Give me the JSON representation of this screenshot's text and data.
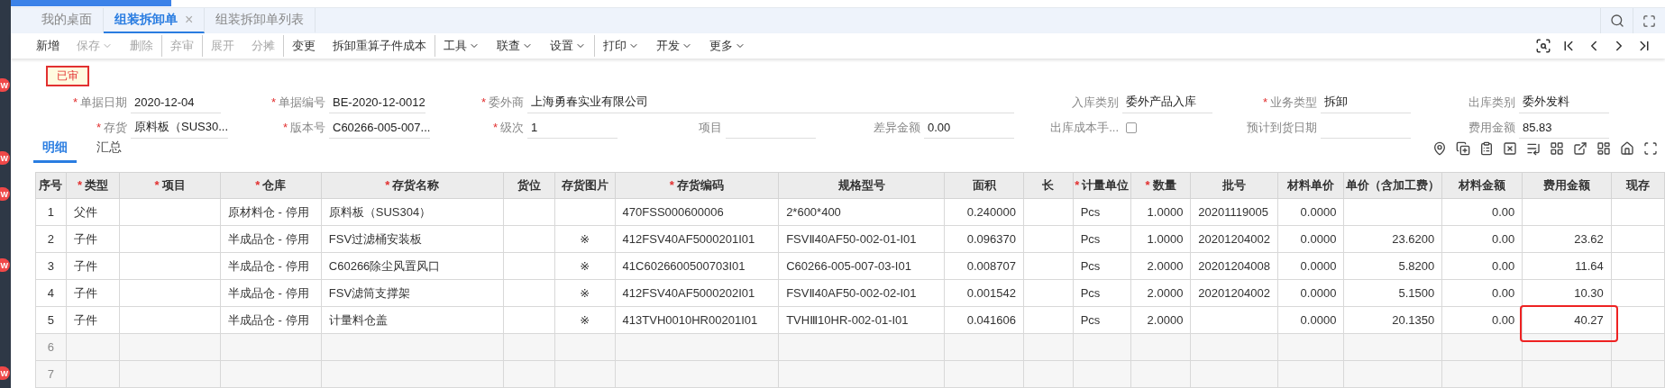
{
  "side_badges": [
    "W",
    "W",
    "W",
    "W",
    "W"
  ],
  "tabs": [
    {
      "label": "我的桌面",
      "selected": false,
      "closable": false
    },
    {
      "label": "组装拆卸单",
      "selected": true,
      "closable": true
    },
    {
      "label": "组装拆卸单列表",
      "selected": false,
      "closable": false
    }
  ],
  "close_glyph": "×",
  "toolbar": [
    {
      "label": "新增",
      "disabled": false,
      "dropdown": false,
      "separator_before": false
    },
    {
      "label": "保存",
      "disabled": true,
      "dropdown": true,
      "separator_before": false
    },
    {
      "label": "删除",
      "disabled": true,
      "dropdown": false,
      "separator_before": false
    },
    {
      "label": "弃审",
      "disabled": true,
      "dropdown": false,
      "separator_before": true
    },
    {
      "label": "展开",
      "disabled": true,
      "dropdown": false,
      "separator_before": true
    },
    {
      "label": "分摊",
      "disabled": true,
      "dropdown": false,
      "separator_before": false
    },
    {
      "label": "变更",
      "disabled": false,
      "dropdown": false,
      "separator_before": true
    },
    {
      "label": "拆卸重算子件成本",
      "disabled": false,
      "dropdown": false,
      "separator_before": false
    },
    {
      "label": "工具",
      "disabled": false,
      "dropdown": true,
      "separator_before": true
    },
    {
      "label": "联查",
      "disabled": false,
      "dropdown": true,
      "separator_before": false
    },
    {
      "label": "设置",
      "disabled": false,
      "dropdown": true,
      "separator_before": false
    },
    {
      "label": "打印",
      "disabled": false,
      "dropdown": true,
      "separator_before": true
    },
    {
      "label": "开发",
      "disabled": false,
      "dropdown": true,
      "separator_before": false
    },
    {
      "label": "更多",
      "disabled": false,
      "dropdown": true,
      "separator_before": false
    }
  ],
  "status_stamp": "已审",
  "required_mark": "*",
  "form_rows": [
    [
      {
        "label": "单据日期",
        "value": "2020-12-04",
        "required": true,
        "kind": "text"
      },
      {
        "label": "单据编号",
        "value": "BE-2020-12-0012",
        "required": true,
        "kind": "text"
      },
      {
        "label": "委外商",
        "value": "上海勇春实业有限公司",
        "required": true,
        "kind": "text"
      },
      {
        "label": "入库类别",
        "value": "委外产品入库",
        "required": false,
        "kind": "text"
      },
      {
        "label": "业务类型",
        "value": "拆卸",
        "required": true,
        "kind": "text"
      },
      {
        "label": "出库类别",
        "value": "委外发料",
        "required": false,
        "kind": "text"
      }
    ],
    [
      {
        "label": "存货",
        "value": "原料板（SUS30...",
        "required": true,
        "kind": "text"
      },
      {
        "label": "版本号",
        "value": "C60266-005-007...",
        "required": true,
        "kind": "text"
      },
      {
        "label": "级次",
        "value": "1",
        "required": true,
        "kind": "text"
      },
      {
        "label": "项目",
        "required": false,
        "kind": "text"
      },
      {
        "label": "差异金额",
        "value": "0.00",
        "required": false,
        "kind": "text"
      },
      {
        "label": "出库成本手...",
        "checked": false,
        "required": false,
        "kind": "checkbox"
      },
      {
        "label": "预计到货日期",
        "required": false,
        "kind": "text"
      },
      {
        "label": "费用金额",
        "value": "85.83",
        "required": false,
        "kind": "text"
      }
    ]
  ],
  "detail_tabs": [
    {
      "label": "明细",
      "selected": true
    },
    {
      "label": "汇总",
      "selected": false
    }
  ],
  "table": {
    "columns": [
      {
        "label": "序号",
        "required": false,
        "kind": "center"
      },
      {
        "label": "类型",
        "required": true,
        "kind": "text"
      },
      {
        "label": "项目",
        "required": true,
        "kind": "text"
      },
      {
        "label": "仓库",
        "required": true,
        "kind": "text"
      },
      {
        "label": "存货名称",
        "required": true,
        "kind": "text"
      },
      {
        "label": "货位",
        "required": false,
        "kind": "text"
      },
      {
        "label": "存货图片",
        "required": false,
        "kind": "center"
      },
      {
        "label": "存货编码",
        "required": true,
        "kind": "text"
      },
      {
        "label": "规格型号",
        "required": false,
        "kind": "text"
      },
      {
        "label": "面积",
        "required": false,
        "kind": "number"
      },
      {
        "label": "长",
        "required": false,
        "kind": "number"
      },
      {
        "label": "计量单位",
        "required": true,
        "kind": "text"
      },
      {
        "label": "数量",
        "required": true,
        "kind": "number"
      },
      {
        "label": "批号",
        "required": false,
        "kind": "text"
      },
      {
        "label": "材料单价",
        "required": false,
        "kind": "number"
      },
      {
        "label": "单价（含加工费）",
        "required": false,
        "kind": "number"
      },
      {
        "label": "材料金额",
        "required": false,
        "kind": "number"
      },
      {
        "label": "费用金额",
        "required": false,
        "kind": "number"
      },
      {
        "label": "现存",
        "required": false,
        "kind": "number"
      }
    ],
    "rows": [
      {
        "blank": false,
        "annotated": false,
        "cells": [
          "1",
          "父件",
          "",
          "原材料仓 - 停用",
          "原料板（SUS304）",
          "",
          "",
          "470FSS000600006",
          "2*600*400",
          "0.240000",
          "",
          "Pcs",
          "1.0000",
          "20201119005",
          "0.0000",
          "",
          "0.00",
          "",
          ""
        ]
      },
      {
        "blank": false,
        "annotated": false,
        "cells": [
          "2",
          "子件",
          "",
          "半成品仓 - 停用",
          "FSV过滤桶安装板",
          "",
          "※",
          "412FSV40AF5000201I01",
          "FSVⅡ40AF50-002-01-I01",
          "0.096370",
          "",
          "Pcs",
          "1.0000",
          "20201204002",
          "0.0000",
          "23.6200",
          "0.00",
          "23.62",
          ""
        ]
      },
      {
        "blank": false,
        "annotated": false,
        "cells": [
          "3",
          "子件",
          "",
          "半成品仓 - 停用",
          "C60266除尘风置风口",
          "",
          "※",
          "41C6026600500703I01",
          "C60266-005-007-03-I01",
          "0.008707",
          "",
          "Pcs",
          "2.0000",
          "20201204008",
          "0.0000",
          "5.8200",
          "0.00",
          "11.64",
          ""
        ]
      },
      {
        "blank": false,
        "annotated": false,
        "cells": [
          "4",
          "子件",
          "",
          "半成品仓 - 停用",
          "FSV滤筒支撑架",
          "",
          "※",
          "412FSV40AF5000202I01",
          "FSVⅡ40AF50-002-02-I01",
          "0.001542",
          "",
          "Pcs",
          "2.0000",
          "20201204002",
          "0.0000",
          "5.1500",
          "0.00",
          "10.30",
          ""
        ]
      },
      {
        "blank": false,
        "annotated": true,
        "cells": [
          "5",
          "子件",
          "",
          "半成品仓 - 停用",
          "计量料仓盖",
          "",
          "※",
          "413TVH0010HR00201I01",
          "TVHⅢ10HR-002-01-I01",
          "0.041606",
          "",
          "Pcs",
          "2.0000",
          "",
          "0.0000",
          "20.1350",
          "0.00",
          "40.27",
          ""
        ]
      },
      {
        "blank": true,
        "annotated": false,
        "cells": [
          "6",
          "",
          "",
          "",
          "",
          "",
          "",
          "",
          "",
          "",
          "",
          "",
          "",
          "",
          "",
          "",
          "",
          "",
          ""
        ]
      },
      {
        "blank": true,
        "annotated": false,
        "cells": [
          "7",
          "",
          "",
          "",
          "",
          "",
          "",
          "",
          "",
          "",
          "",
          "",
          "",
          "",
          "",
          "",
          "",
          "",
          ""
        ]
      }
    ]
  }
}
